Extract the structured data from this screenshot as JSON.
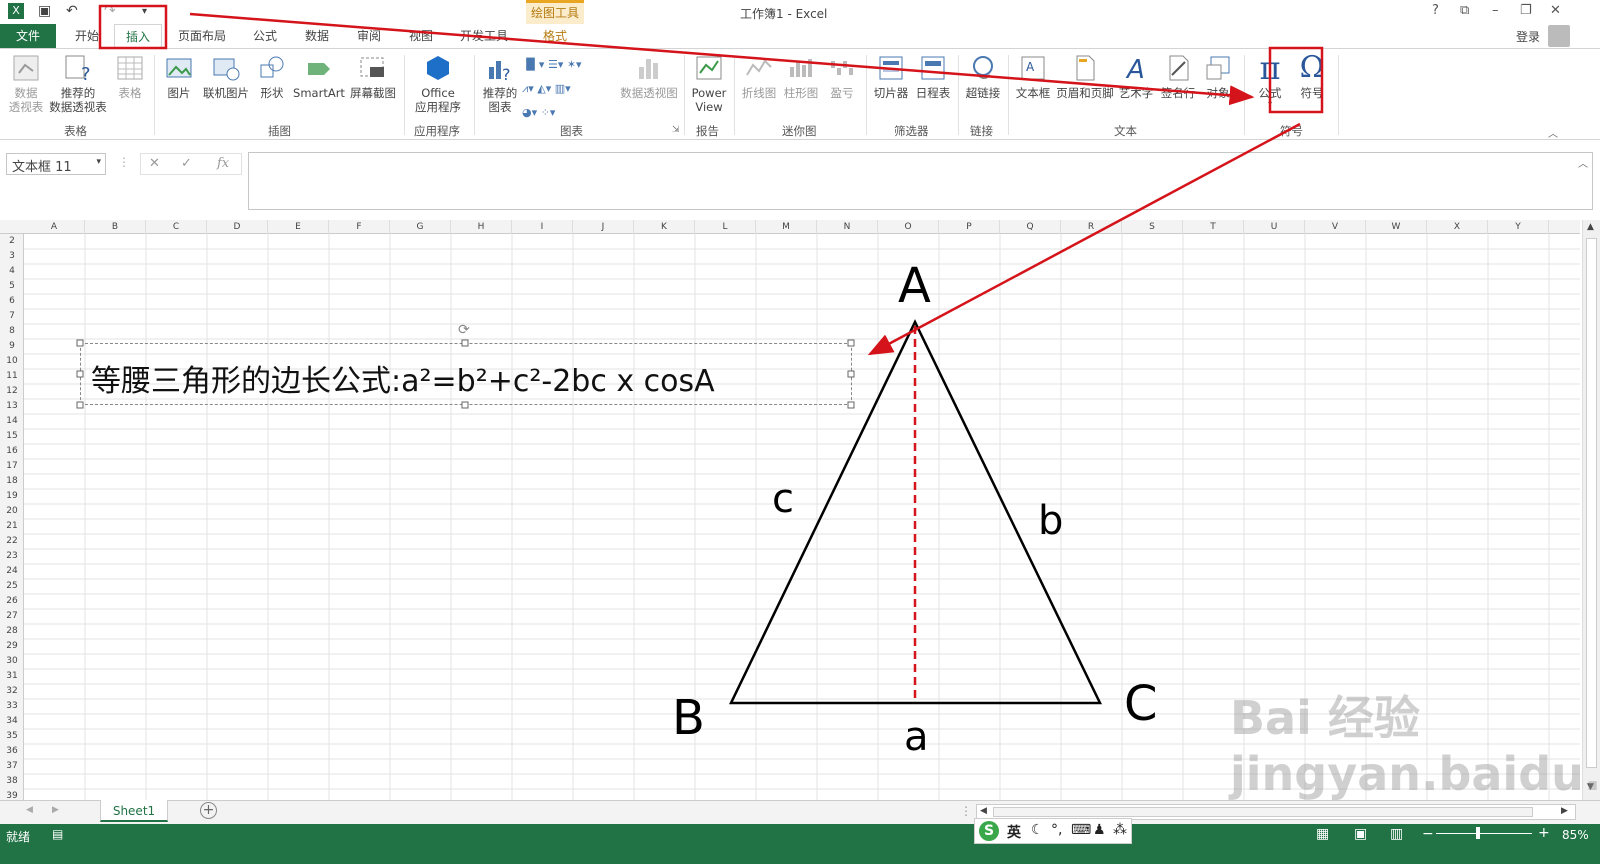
{
  "window": {
    "title": "工作簿1 - Excel",
    "context_tab": "绘图工具",
    "help": "?",
    "login": "登录"
  },
  "tabs": {
    "file": "文件",
    "home": "开始",
    "insert": "插入",
    "layout": "页面布局",
    "formulas": "公式",
    "data": "数据",
    "review": "审阅",
    "view": "视图",
    "developer": "开发工具",
    "format": "格式"
  },
  "ribbon": {
    "pivot": "数据\n透视表",
    "rec_pivot": "推荐的\n数据透视表",
    "table": "表格",
    "group_tables": "表格",
    "picture": "图片",
    "online_picture": "联机图片",
    "shapes": "形状",
    "smartart": "SmartArt",
    "screenshot": "屏幕截图",
    "group_illustrations": "插图",
    "office_apps": "Office\n应用程序",
    "group_apps": "应用程序",
    "rec_charts": "推荐的\n图表",
    "pivot_chart": "数据透视图",
    "group_charts": "图表",
    "power_view": "Power\nView",
    "group_reports": "报告",
    "spark_line": "折线图",
    "spark_column": "柱形图",
    "spark_winloss": "盈亏",
    "group_sparklines": "迷你图",
    "slicer": "切片器",
    "timeline": "日程表",
    "group_filters": "筛选器",
    "hyperlink": "超链接",
    "group_links": "链接",
    "textbox": "文本框",
    "header_footer": "页眉和页脚",
    "wordart": "艺术字",
    "signature": "签名行",
    "object": "对象",
    "group_text": "文本",
    "equation": "公式",
    "symbol": "符号",
    "group_symbols": "符号"
  },
  "formula_bar": {
    "namebox": "文本框 11",
    "fx": "fx"
  },
  "columns": [
    "A",
    "B",
    "C",
    "D",
    "E",
    "F",
    "G",
    "H",
    "I",
    "J",
    "K",
    "L",
    "M",
    "N",
    "O",
    "P",
    "Q",
    "R",
    "S",
    "T",
    "U",
    "V",
    "W",
    "X",
    "Y"
  ],
  "rows": [
    "2",
    "3",
    "4",
    "5",
    "6",
    "7",
    "8",
    "9",
    "10",
    "11",
    "12",
    "13",
    "14",
    "15",
    "16",
    "17",
    "18",
    "19",
    "20",
    "21",
    "22",
    "23",
    "24",
    "25",
    "26",
    "27",
    "28",
    "29",
    "30",
    "31",
    "32",
    "33",
    "34",
    "35",
    "36",
    "37",
    "38",
    "39"
  ],
  "drawing": {
    "textbox_text": "等腰三角形的边长公式:a²=b²+c²-2bc x cosA",
    "vertex_a": "A",
    "vertex_b": "B",
    "vertex_c": "C",
    "side_a": "a",
    "side_b": "b",
    "side_c": "c"
  },
  "sheet": {
    "tab": "Sheet1"
  },
  "status": {
    "ready": "就绪",
    "ime": "英",
    "zoom": "85%"
  },
  "watermark": "Bai 经验  jingyan.baidu.com",
  "colors": {
    "excel_green": "#217346",
    "annotation_red": "#d4141a"
  }
}
